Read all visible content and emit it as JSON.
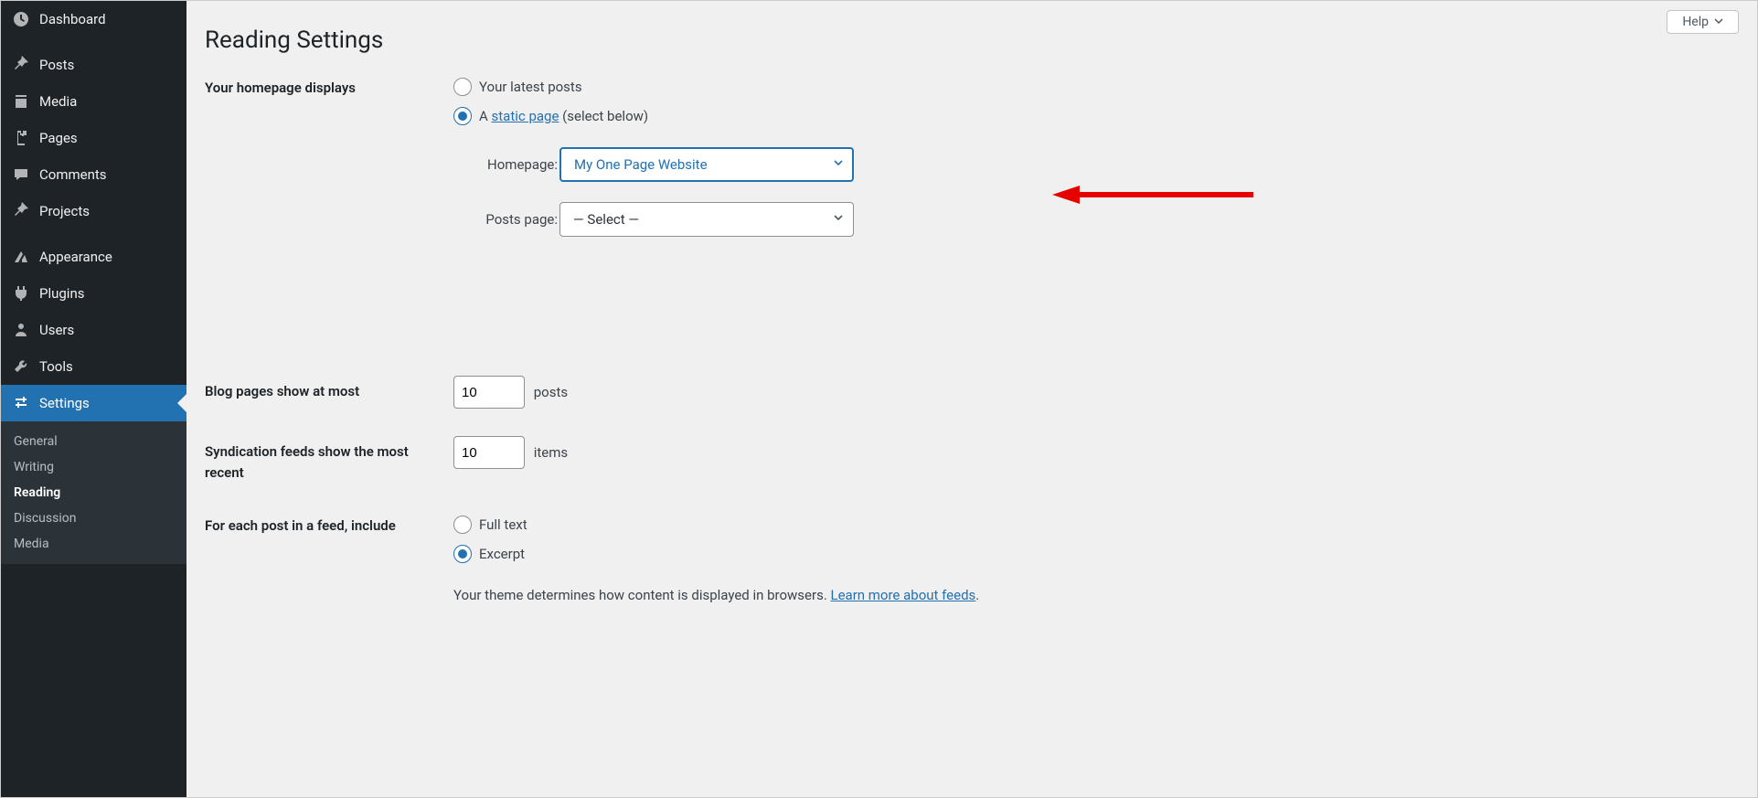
{
  "header": {
    "help_label": "Help"
  },
  "page": {
    "title": "Reading Settings"
  },
  "sidebar": {
    "items": [
      {
        "label": "Dashboard"
      },
      {
        "label": "Posts"
      },
      {
        "label": "Media"
      },
      {
        "label": "Pages"
      },
      {
        "label": "Comments"
      },
      {
        "label": "Projects"
      },
      {
        "label": "Appearance"
      },
      {
        "label": "Plugins"
      },
      {
        "label": "Users"
      },
      {
        "label": "Tools"
      },
      {
        "label": "Settings"
      }
    ],
    "submenu": [
      {
        "label": "General"
      },
      {
        "label": "Writing"
      },
      {
        "label": "Reading"
      },
      {
        "label": "Discussion"
      },
      {
        "label": "Media"
      }
    ]
  },
  "settings": {
    "homepage_displays_label": "Your homepage displays",
    "radio_latest_posts": "Your latest posts",
    "radio_static_prefix": "A ",
    "radio_static_link": "static page",
    "radio_static_suffix": " (select below)",
    "homepage_label": "Homepage:",
    "homepage_value": "My One Page Website",
    "posts_page_label": "Posts page:",
    "posts_page_value": "— Select —",
    "blog_pages_label": "Blog pages show at most",
    "blog_pages_value": "10",
    "blog_pages_suffix": "posts",
    "syndication_label": "Syndication feeds show the most recent",
    "syndication_value": "10",
    "syndication_suffix": "items",
    "feed_include_label": "For each post in a feed, include",
    "feed_full_text": "Full text",
    "feed_excerpt": "Excerpt",
    "feed_note_prefix": "Your theme determines how content is displayed in browsers. ",
    "feed_note_link": "Learn more about feeds",
    "feed_note_suffix": "."
  }
}
